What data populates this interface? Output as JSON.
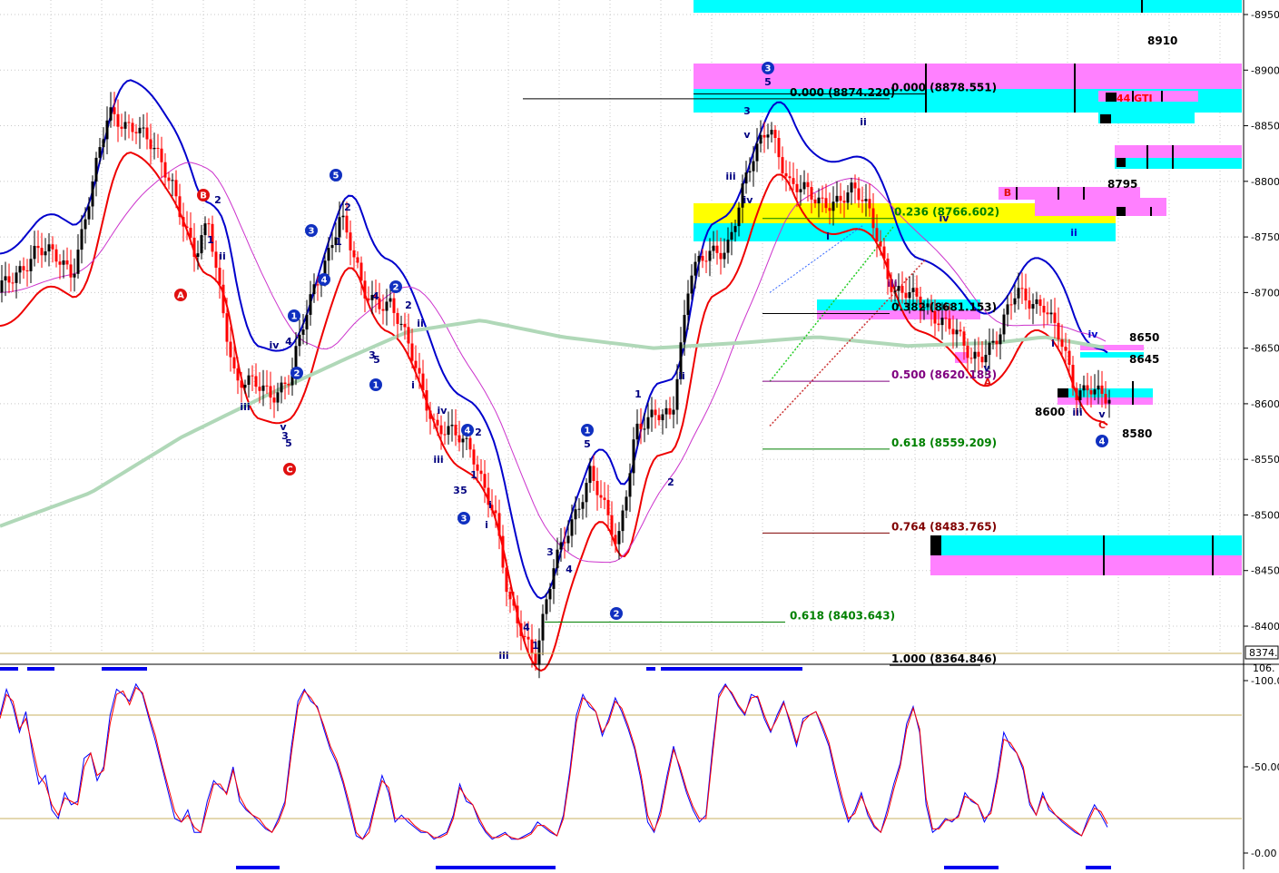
{
  "chart_data": [
    {
      "type": "candlestick",
      "title": "",
      "ylim": [
        8374,
        8960
      ],
      "y_ticks": [
        "8950",
        "8900",
        "8850",
        "8800",
        "8750",
        "8700",
        "8650",
        "8600",
        "8550",
        "8500",
        "8450",
        "8400"
      ],
      "last_price": "8374.",
      "fib_levels": [
        {
          "label": "0.000 (8874.220)",
          "value": 8874.22,
          "color": "#000000"
        },
        {
          "label": "0.000 (8878.551)",
          "value": 8878.551,
          "color": "#000000"
        },
        {
          "label": "0.236 (8766.602)",
          "value": 8766.602,
          "color": "#008000"
        },
        {
          "label": "0.382 (8681.153)",
          "value": 8681.153,
          "color": "#000000"
        },
        {
          "label": "0.500 (8620.183)",
          "value": 8620.183,
          "color": "#800080"
        },
        {
          "label": "0.618 (8559.209)",
          "value": 8559.209,
          "color": "#008000"
        },
        {
          "label": "0.764 (8483.765)",
          "value": 8483.765,
          "color": "#800000"
        },
        {
          "label": "0.618 (8403.643)",
          "value": 8403.643,
          "color": "#008000"
        },
        {
          "label": "1.000 (8364.846)",
          "value": 8364.846,
          "color": "#000000"
        }
      ],
      "price_notes": [
        "8910",
        "8795",
        "8650",
        "8645",
        "8600",
        "8580"
      ],
      "zone_label": "44 GTI",
      "wave_labels": {
        "circled_blue": [
          "1",
          "2",
          "3",
          "4",
          "5"
        ],
        "circled_red": [
          "A",
          "B",
          "C"
        ],
        "roman": [
          "i",
          "ii",
          "iii",
          "iv",
          "v"
        ],
        "arabic": [
          "1",
          "2",
          "3",
          "4",
          "5"
        ],
        "letters": [
          "A",
          "B",
          "C"
        ]
      },
      "colors": {
        "up": "#000000",
        "down": "#ff0000",
        "blue": "#0000cc",
        "cyan": "#00ffff",
        "magenta": "#ff80ff",
        "yellow": "#ffff00",
        "ma": "#b0d8b8"
      }
    },
    {
      "type": "line",
      "title": "",
      "ylim": [
        0,
        106
      ],
      "y_ticks": [
        "100.0",
        "50.00",
        "0.00"
      ],
      "top_readout": "106.",
      "series": [
        {
          "name": "",
          "color": "#0000ff",
          "values": [
            80,
            95,
            85,
            70,
            82,
            58,
            40,
            45,
            25,
            20,
            35,
            28,
            30,
            55,
            58,
            42,
            50,
            80,
            95,
            92,
            88,
            98,
            92,
            78,
            65,
            50,
            35,
            20,
            18,
            25,
            12,
            12,
            30,
            42,
            38,
            35,
            50,
            30,
            25,
            22,
            18,
            14,
            12,
            20,
            30,
            62,
            88,
            95,
            88,
            85,
            72,
            60,
            52,
            40,
            25,
            10,
            8,
            15,
            30,
            45,
            35,
            18,
            22,
            18,
            15,
            12,
            12,
            8,
            10,
            12,
            22,
            40,
            30,
            28,
            18,
            12,
            8,
            10,
            12,
            8,
            8,
            10,
            12,
            18,
            15,
            12,
            10,
            22,
            48,
            80,
            92,
            85,
            82,
            68,
            78,
            90,
            82,
            72,
            60,
            42,
            18,
            12,
            25,
            45,
            62,
            48,
            35,
            25,
            18,
            22,
            60,
            92,
            98,
            92,
            85,
            80,
            92,
            90,
            78,
            70,
            80,
            88,
            75,
            62,
            78,
            80,
            82,
            72,
            62,
            45,
            30,
            18,
            25,
            35,
            22,
            15,
            12,
            25,
            40,
            52,
            75,
            85,
            70,
            28,
            12,
            15,
            20,
            18,
            22,
            35,
            30,
            28,
            18,
            25,
            45,
            70,
            62,
            58,
            48,
            28,
            22,
            35,
            25,
            22,
            18,
            15,
            12,
            10,
            20,
            28,
            22,
            15
          ]
        },
        {
          "name": "",
          "color": "#ff0000",
          "values": [
            78,
            92,
            88,
            72,
            78,
            62,
            45,
            40,
            28,
            22,
            32,
            30,
            28,
            50,
            58,
            45,
            48,
            75,
            92,
            94,
            86,
            96,
            93,
            80,
            68,
            52,
            38,
            24,
            18,
            22,
            15,
            12,
            26,
            40,
            40,
            34,
            48,
            33,
            26,
            22,
            20,
            15,
            12,
            18,
            28,
            58,
            85,
            94,
            90,
            84,
            74,
            62,
            54,
            42,
            28,
            12,
            8,
            12,
            28,
            42,
            38,
            20,
            20,
            20,
            16,
            13,
            12,
            9,
            9,
            11,
            20,
            38,
            32,
            28,
            20,
            13,
            9,
            9,
            11,
            9,
            8,
            9,
            11,
            16,
            16,
            13,
            10,
            20,
            45,
            76,
            90,
            87,
            82,
            70,
            76,
            88,
            84,
            74,
            62,
            45,
            22,
            13,
            22,
            42,
            60,
            50,
            37,
            27,
            20,
            20,
            56,
            90,
            97,
            93,
            86,
            81,
            90,
            91,
            80,
            71,
            78,
            87,
            77,
            64,
            76,
            80,
            82,
            74,
            64,
            48,
            33,
            20,
            23,
            33,
            24,
            16,
            12,
            22,
            37,
            50,
            72,
            84,
            72,
            32,
            14,
            14,
            19,
            19,
            21,
            33,
            31,
            28,
            20,
            23,
            42,
            66,
            64,
            58,
            50,
            30,
            22,
            33,
            27,
            22,
            19,
            16,
            13,
            10,
            18,
            26,
            24,
            17
          ]
        }
      ]
    }
  ]
}
